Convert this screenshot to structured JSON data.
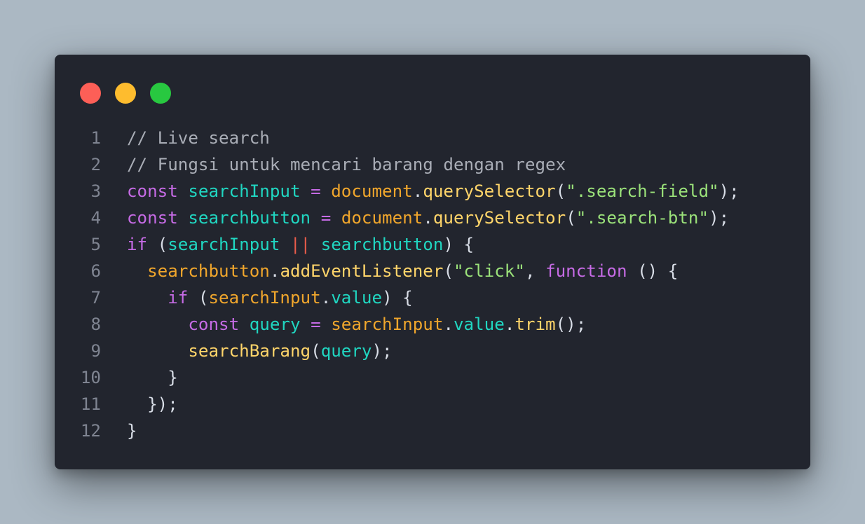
{
  "colors": {
    "background": "#abb8c3",
    "window": "#22252e",
    "line_number": "#7f8491",
    "default": "#d8dde6",
    "comment": "#a9adb6",
    "keyword": "#c66be5",
    "variable": "#20d6c1",
    "object": "#f0a62c",
    "method": "#ffd56a",
    "string": "#9be27a",
    "operator": "#ea5c4b"
  },
  "window_controls": [
    {
      "name": "close-button",
      "color": "#fd5f57"
    },
    {
      "name": "minimize-button",
      "color": "#febc2e"
    },
    {
      "name": "maximize-button",
      "color": "#28c840"
    }
  ],
  "code": {
    "lines": [
      {
        "number": "1",
        "tokens": [
          {
            "t": "// Live search",
            "k": "comment"
          }
        ]
      },
      {
        "number": "2",
        "tokens": [
          {
            "t": "// Fungsi untuk mencari barang dengan regex",
            "k": "comment"
          }
        ]
      },
      {
        "number": "3",
        "tokens": [
          {
            "t": "const",
            "k": "keyword"
          },
          {
            "t": " ",
            "k": "default"
          },
          {
            "t": "searchInput",
            "k": "variable"
          },
          {
            "t": " ",
            "k": "default"
          },
          {
            "t": "=",
            "k": "keyword"
          },
          {
            "t": " ",
            "k": "default"
          },
          {
            "t": "document",
            "k": "object"
          },
          {
            "t": ".",
            "k": "default"
          },
          {
            "t": "querySelector",
            "k": "method"
          },
          {
            "t": "(",
            "k": "default"
          },
          {
            "t": "\".search-field\"",
            "k": "string"
          },
          {
            "t": ");",
            "k": "default"
          }
        ]
      },
      {
        "number": "4",
        "tokens": [
          {
            "t": "const",
            "k": "keyword"
          },
          {
            "t": " ",
            "k": "default"
          },
          {
            "t": "searchbutton",
            "k": "variable"
          },
          {
            "t": " ",
            "k": "default"
          },
          {
            "t": "=",
            "k": "keyword"
          },
          {
            "t": " ",
            "k": "default"
          },
          {
            "t": "document",
            "k": "object"
          },
          {
            "t": ".",
            "k": "default"
          },
          {
            "t": "querySelector",
            "k": "method"
          },
          {
            "t": "(",
            "k": "default"
          },
          {
            "t": "\".search-btn\"",
            "k": "string"
          },
          {
            "t": ");",
            "k": "default"
          }
        ]
      },
      {
        "number": "5",
        "tokens": [
          {
            "t": "if",
            "k": "keyword"
          },
          {
            "t": " (",
            "k": "default"
          },
          {
            "t": "searchInput",
            "k": "variable"
          },
          {
            "t": " ",
            "k": "default"
          },
          {
            "t": "||",
            "k": "operator"
          },
          {
            "t": " ",
            "k": "default"
          },
          {
            "t": "searchbutton",
            "k": "variable"
          },
          {
            "t": ") {",
            "k": "default"
          }
        ]
      },
      {
        "number": "6",
        "tokens": [
          {
            "t": "  ",
            "k": "default"
          },
          {
            "t": "searchbutton",
            "k": "object"
          },
          {
            "t": ".",
            "k": "default"
          },
          {
            "t": "addEventListener",
            "k": "method"
          },
          {
            "t": "(",
            "k": "default"
          },
          {
            "t": "\"click\"",
            "k": "string"
          },
          {
            "t": ", ",
            "k": "default"
          },
          {
            "t": "function",
            "k": "keyword"
          },
          {
            "t": " () {",
            "k": "default"
          }
        ]
      },
      {
        "number": "7",
        "tokens": [
          {
            "t": "    ",
            "k": "default"
          },
          {
            "t": "if",
            "k": "keyword"
          },
          {
            "t": " (",
            "k": "default"
          },
          {
            "t": "searchInput",
            "k": "object"
          },
          {
            "t": ".",
            "k": "default"
          },
          {
            "t": "value",
            "k": "variable"
          },
          {
            "t": ") {",
            "k": "default"
          }
        ]
      },
      {
        "number": "8",
        "tokens": [
          {
            "t": "      ",
            "k": "default"
          },
          {
            "t": "const",
            "k": "keyword"
          },
          {
            "t": " ",
            "k": "default"
          },
          {
            "t": "query",
            "k": "variable"
          },
          {
            "t": " ",
            "k": "default"
          },
          {
            "t": "=",
            "k": "keyword"
          },
          {
            "t": " ",
            "k": "default"
          },
          {
            "t": "searchInput",
            "k": "object"
          },
          {
            "t": ".",
            "k": "default"
          },
          {
            "t": "value",
            "k": "variable"
          },
          {
            "t": ".",
            "k": "default"
          },
          {
            "t": "trim",
            "k": "method"
          },
          {
            "t": "();",
            "k": "default"
          }
        ]
      },
      {
        "number": "9",
        "tokens": [
          {
            "t": "      ",
            "k": "default"
          },
          {
            "t": "searchBarang",
            "k": "method"
          },
          {
            "t": "(",
            "k": "default"
          },
          {
            "t": "query",
            "k": "variable"
          },
          {
            "t": ");",
            "k": "default"
          }
        ]
      },
      {
        "number": "10",
        "tokens": [
          {
            "t": "    }",
            "k": "default"
          }
        ]
      },
      {
        "number": "11",
        "tokens": [
          {
            "t": "  });",
            "k": "default"
          }
        ]
      },
      {
        "number": "12",
        "tokens": [
          {
            "t": "}",
            "k": "default"
          }
        ]
      }
    ]
  }
}
